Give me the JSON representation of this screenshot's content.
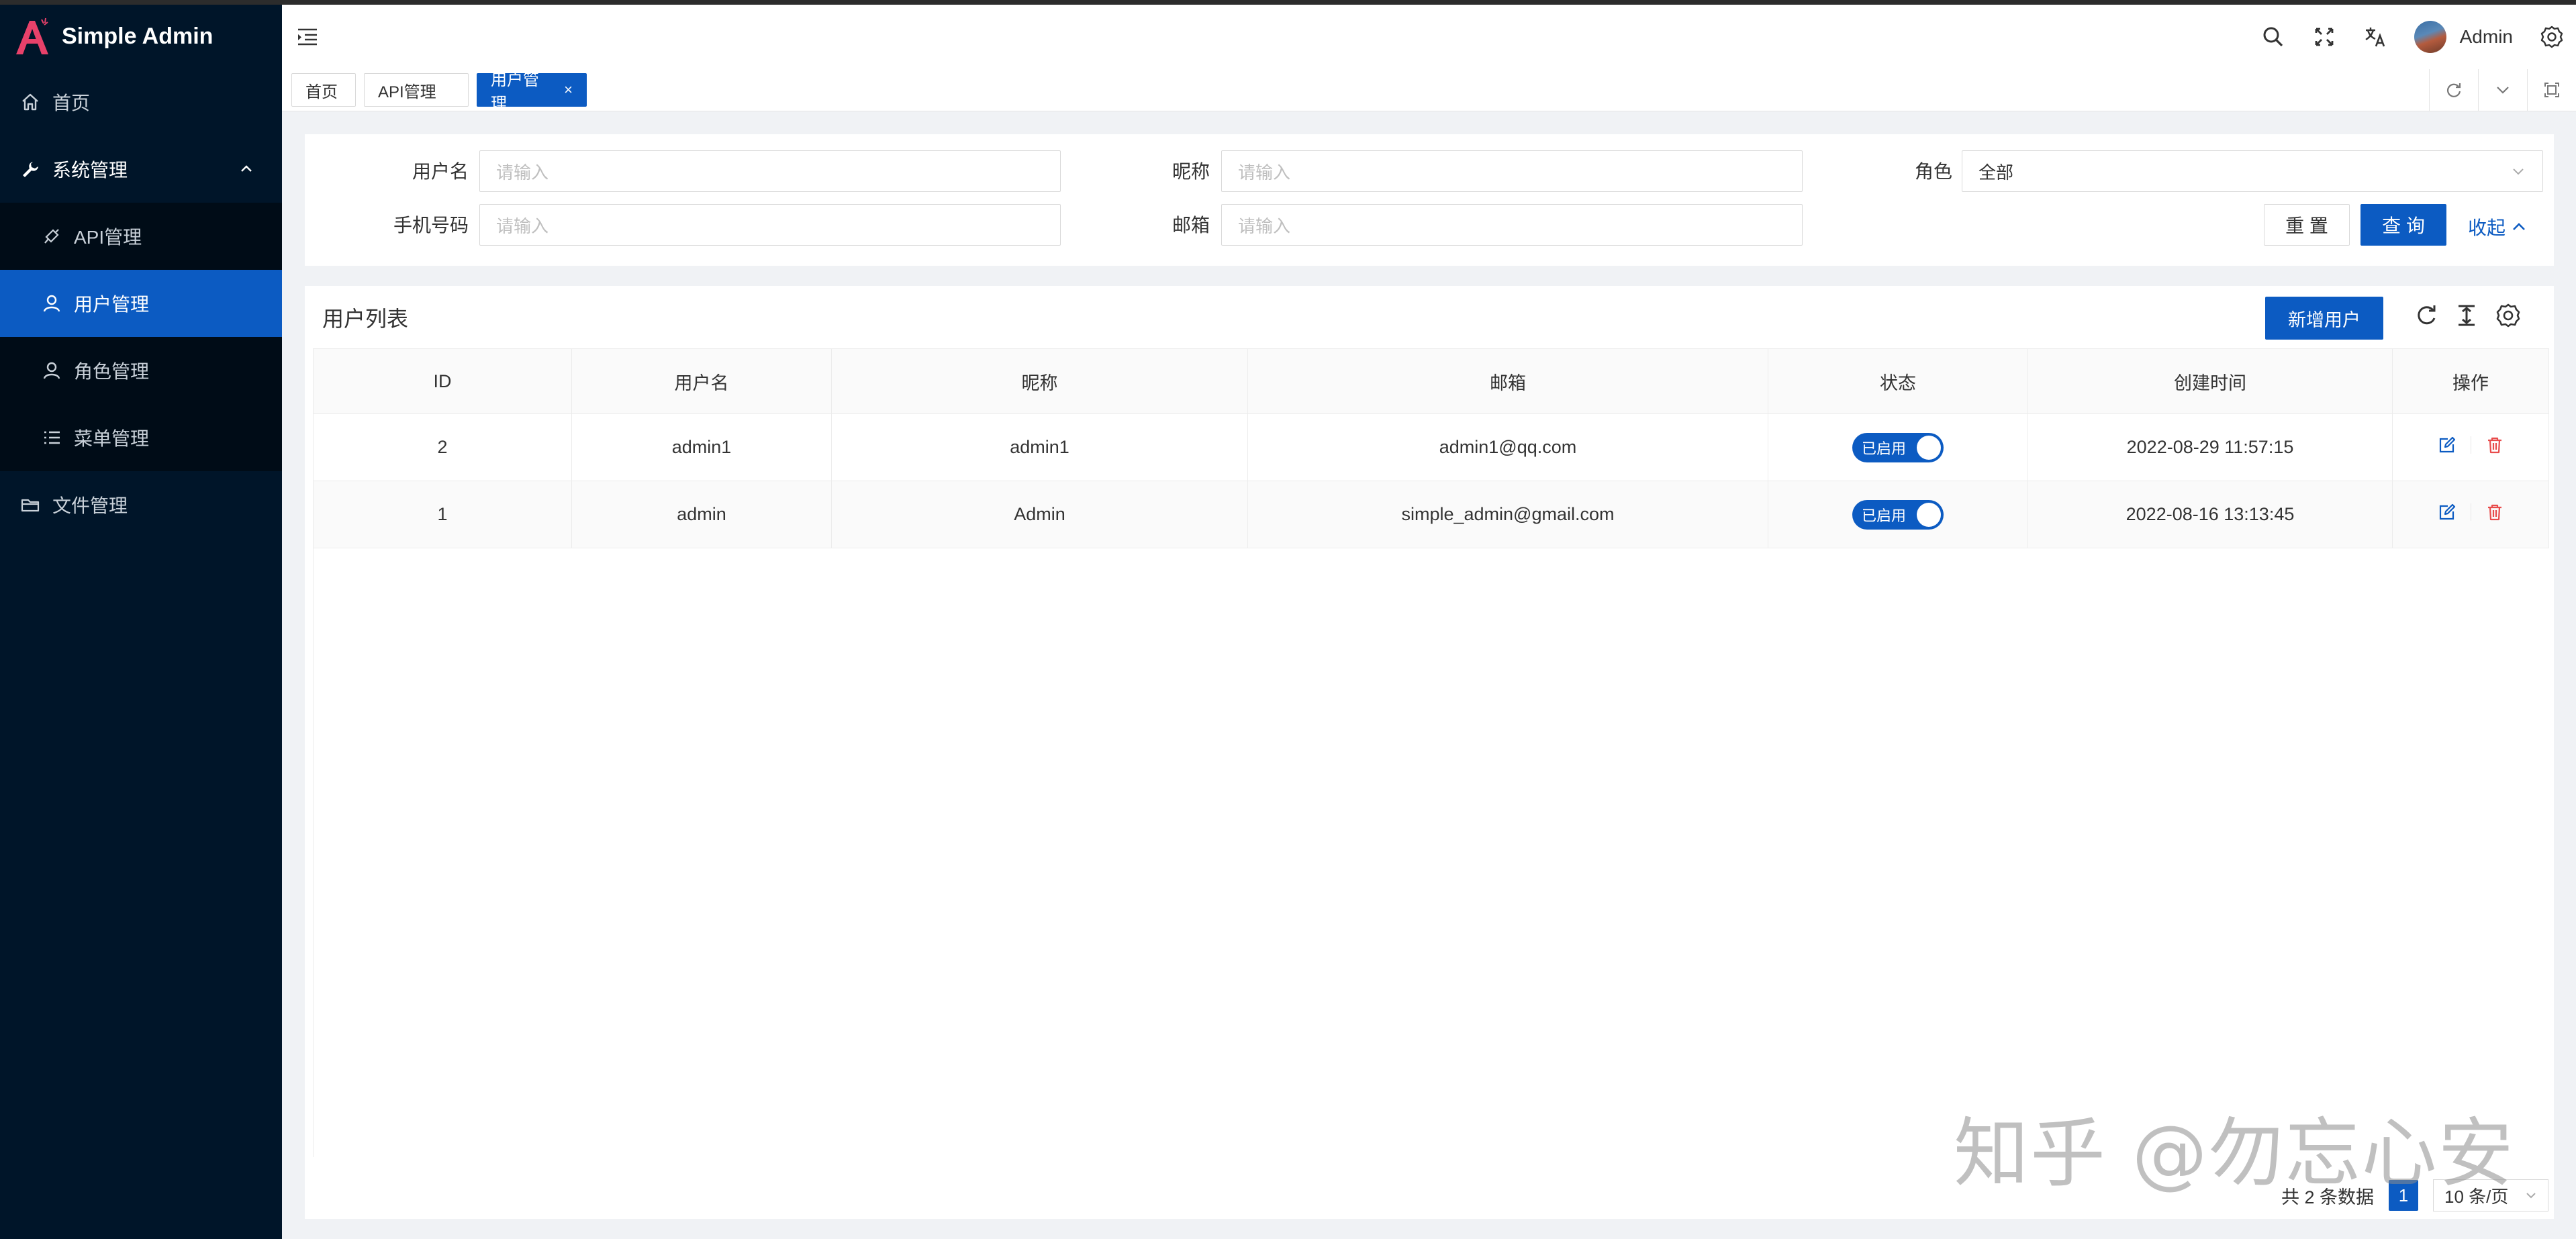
{
  "app": {
    "title": "Simple Admin",
    "brand_color": "#0c5bc2",
    "sidebar_bg": "#001529"
  },
  "sidebar": {
    "items": [
      {
        "label": "首页",
        "icon": "home-icon"
      },
      {
        "label": "系统管理",
        "icon": "tool-icon",
        "expanded": true
      },
      {
        "label": "API管理",
        "icon": "api-icon"
      },
      {
        "label": "用户管理",
        "icon": "user-icon",
        "active": true
      },
      {
        "label": "角色管理",
        "icon": "role-icon"
      },
      {
        "label": "菜单管理",
        "icon": "list-icon"
      },
      {
        "label": "文件管理",
        "icon": "folder-icon"
      }
    ]
  },
  "header": {
    "user_name": "Admin"
  },
  "tabs": [
    {
      "label": "首页"
    },
    {
      "label": "API管理"
    },
    {
      "label": "用户管理",
      "active": true,
      "close": "×"
    }
  ],
  "search": {
    "username_label": "用户名",
    "username_placeholder": "请输入",
    "nickname_label": "昵称",
    "nickname_placeholder": "请输入",
    "role_label": "角色",
    "role_value": "全部",
    "mobile_label": "手机号码",
    "mobile_placeholder": "请输入",
    "email_label": "邮箱",
    "email_placeholder": "请输入",
    "reset_label": "重 置",
    "query_label": "查 询",
    "collapse_label": "收起"
  },
  "table": {
    "title": "用户列表",
    "add_label": "新增用户",
    "columns": [
      "ID",
      "用户名",
      "昵称",
      "邮箱",
      "状态",
      "创建时间",
      "操作"
    ],
    "rows": [
      {
        "id": "2",
        "username": "admin1",
        "nickname": "admin1",
        "email": "admin1@qq.com",
        "status": "已启用",
        "created": "2022-08-29 11:57:15"
      },
      {
        "id": "1",
        "username": "admin",
        "nickname": "Admin",
        "email": "simple_admin@gmail.com",
        "status": "已启用",
        "created": "2022-08-16 13:13:45"
      }
    ]
  },
  "pagination": {
    "total_text": "共 2 条数据",
    "current": "1",
    "page_size": "10 条/页"
  },
  "watermark": "知乎 @勿忘心安"
}
